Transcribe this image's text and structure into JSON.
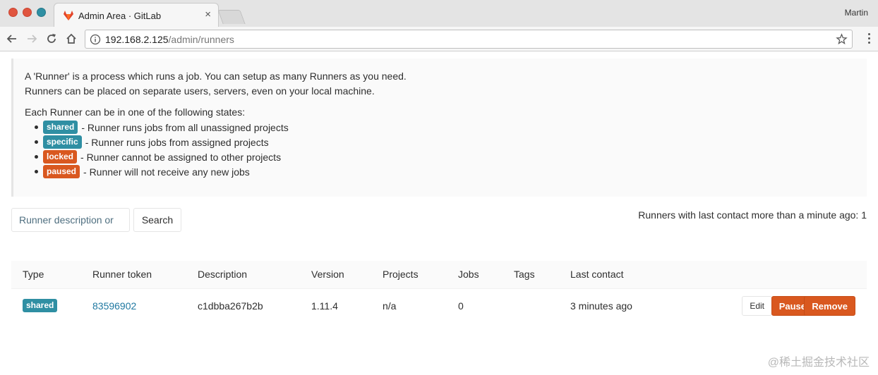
{
  "browser": {
    "tab_title": "Admin Area · GitLab",
    "tab_close": "×",
    "profile_name": "Martin",
    "url_host": "192.168.2.125",
    "url_path": "/admin/runners"
  },
  "info": {
    "line1": "A 'Runner' is a process which runs a job. You can setup as many Runners as you need.",
    "line2": "Runners can be placed on separate users, servers, even on your local machine.",
    "line3": "Each Runner can be in one of the following states:",
    "states": [
      {
        "badge": "shared",
        "text": "- Runner runs jobs from all unassigned projects",
        "color": "#2f8fa3"
      },
      {
        "badge": "specific",
        "text": "- Runner runs jobs from assigned projects",
        "color": "#2f8fa3"
      },
      {
        "badge": "locked",
        "text": "- Runner cannot be assigned to other projects",
        "color": "#d9581f"
      },
      {
        "badge": "paused",
        "text": "- Runner will not receive any new jobs",
        "color": "#d9581f"
      }
    ]
  },
  "search": {
    "placeholder": "Runner description or",
    "button_label": "Search"
  },
  "last_contact_info": "Runners with last contact more than a minute ago: 1",
  "table": {
    "headers": [
      "Type",
      "Runner token",
      "Description",
      "Version",
      "Projects",
      "Jobs",
      "Tags",
      "Last contact"
    ],
    "rows": [
      {
        "type": "shared",
        "token": "83596902",
        "description": "c1dbba267b2b",
        "version": "1.11.4",
        "projects": "n/a",
        "jobs": "0",
        "tags": "",
        "last_contact": "3 minutes ago",
        "edit_label": "Edit",
        "pause_label": "Pause",
        "remove_label": "Remove"
      }
    ]
  },
  "watermark": "@稀土掘金技术社区",
  "colors": {
    "info_badge": "#2f8fa3",
    "warning_badge": "#d9581f",
    "link": "#1f78a1"
  }
}
